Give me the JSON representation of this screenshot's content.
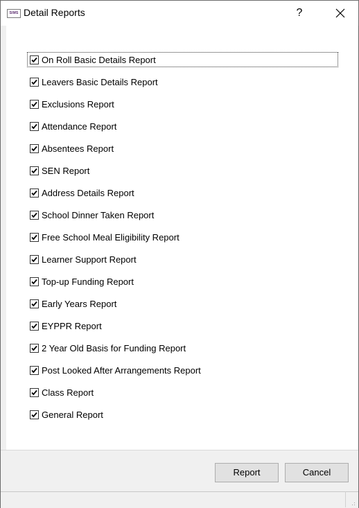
{
  "window": {
    "title": "Detail Reports",
    "app_icon_text": "SIMS",
    "help_label": "?"
  },
  "reports": [
    {
      "label": "On Roll Basic Details Report",
      "checked": true
    },
    {
      "label": "Leavers Basic Details Report",
      "checked": true
    },
    {
      "label": "Exclusions Report",
      "checked": true
    },
    {
      "label": "Attendance Report",
      "checked": true
    },
    {
      "label": "Absentees Report",
      "checked": true
    },
    {
      "label": "SEN Report",
      "checked": true
    },
    {
      "label": "Address Details Report",
      "checked": true
    },
    {
      "label": "School Dinner Taken Report",
      "checked": true
    },
    {
      "label": "Free School Meal Eligibility Report",
      "checked": true
    },
    {
      "label": "Learner Support Report",
      "checked": true
    },
    {
      "label": "Top-up Funding Report",
      "checked": true
    },
    {
      "label": "Early Years Report",
      "checked": true
    },
    {
      "label": "EYPPR Report",
      "checked": true
    },
    {
      "label": "2 Year Old Basis for Funding Report",
      "checked": true
    },
    {
      "label": "Post Looked After Arrangements Report",
      "checked": true
    },
    {
      "label": "Class Report",
      "checked": true
    },
    {
      "label": "General Report",
      "checked": true
    }
  ],
  "footer": {
    "report_label": "Report",
    "cancel_label": "Cancel"
  }
}
